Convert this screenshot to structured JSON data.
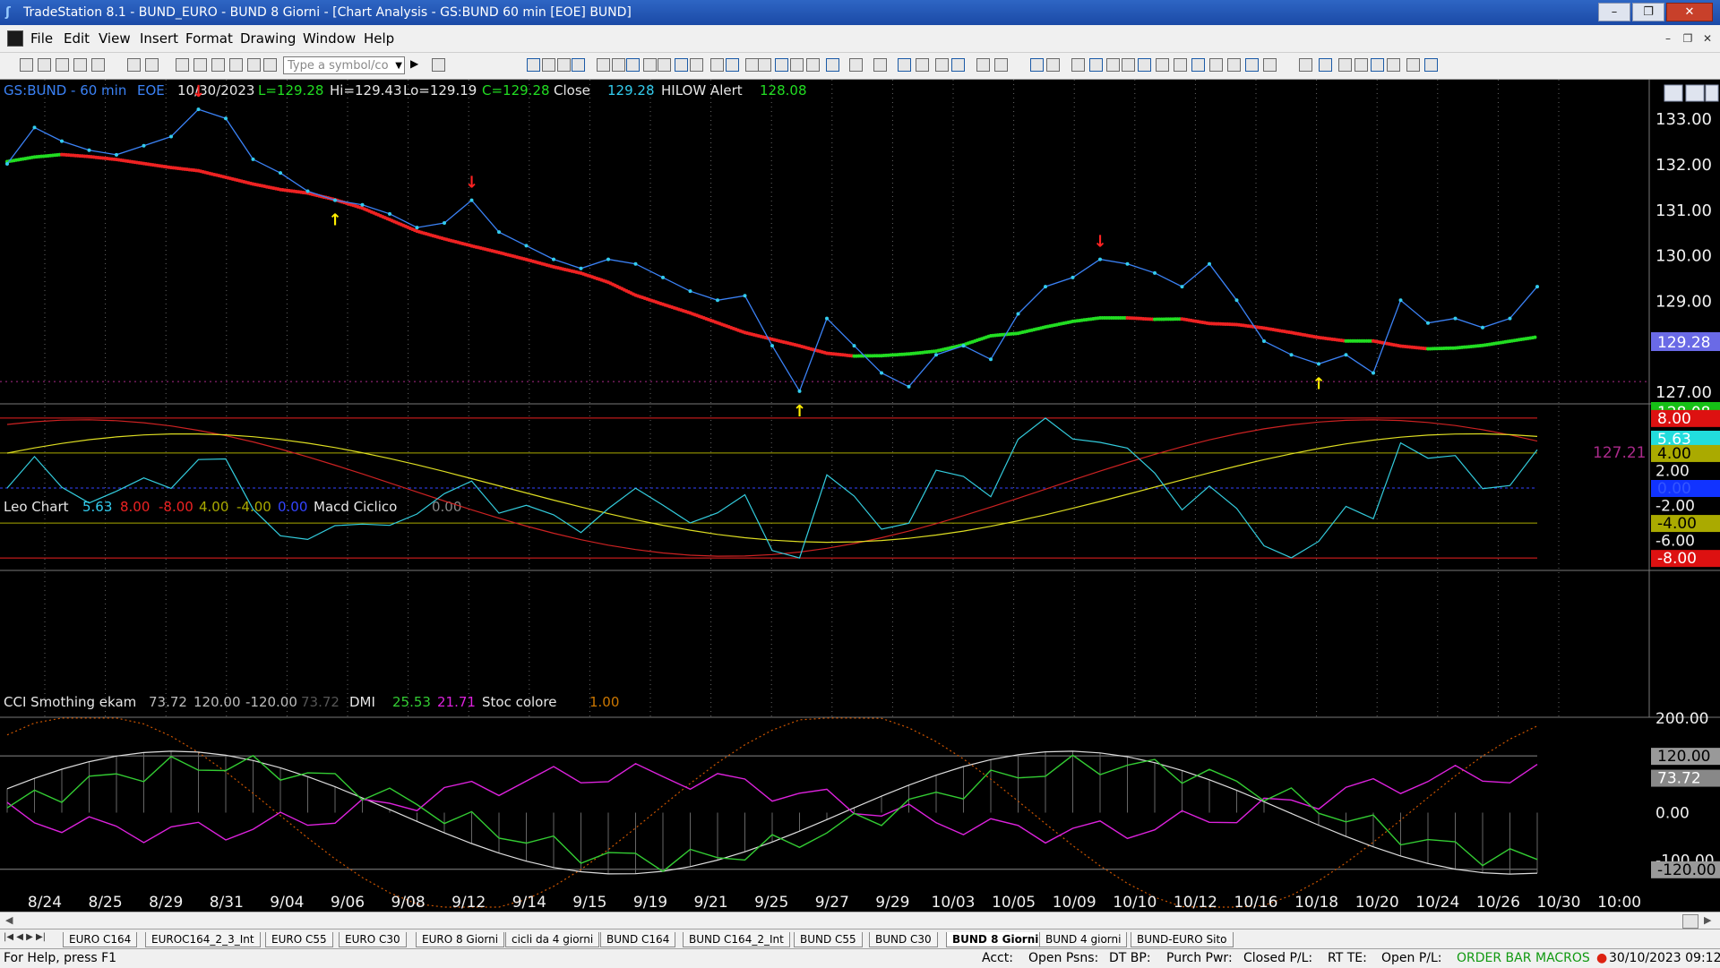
{
  "window": {
    "title": "TradeStation 8.1 - BUND_EURO - BUND 8 Giorni - [Chart Analysis - GS:BUND  60 min  [EOE] BUND]",
    "min_label": "–",
    "max_label": "❐",
    "close_label": "✕"
  },
  "menu": {
    "items": [
      "File",
      "Edit",
      "View",
      "Insert",
      "Format",
      "Drawing",
      "Window",
      "Help"
    ],
    "mdi_buttons": [
      "–",
      "❐",
      "✕"
    ]
  },
  "toolbar": {
    "symbol_placeholder": "Type a symbol/co"
  },
  "price_panel": {
    "header": {
      "symbol": "GS:BUND - 60 min",
      "session": "EOE",
      "date": "10/30/2023",
      "low": "L=129.28",
      "high": "Hi=129.43",
      "lo": "Lo=129.19",
      "close": "C=129.28",
      "close_label": "Close",
      "close_value": "129.28",
      "alert_label": "HILOW Alert",
      "alert_value": "128.08"
    },
    "axis_labels": [
      "133.00",
      "132.00",
      "131.00",
      "130.00",
      "129.00",
      "127.00"
    ],
    "last_price_badge": "129.28",
    "alert_badge": "128.08",
    "ref_line_label": "127.21",
    "ref_line_value": 127.21
  },
  "osc1_panel": {
    "header": {
      "name": "Leo Chart",
      "v1": "5.63",
      "v2": "8.00",
      "v3": "-8.00",
      "v4": "4.00",
      "v5": "-4.00",
      "v6": "0.00",
      "name2": "Macd Ciclico",
      "v7": "0.00"
    },
    "axis_labels": [
      "2.00",
      "-2.00",
      "-6.00"
    ],
    "badges": [
      "8.00",
      "5.63",
      "4.00",
      "0.00",
      "-4.00",
      "-8.00"
    ]
  },
  "osc2_panel": {
    "header": {
      "name": "CCI Smothing ekam",
      "v1": "73.72",
      "v2": "120.00",
      "v3": "-120.00",
      "v4": "73.72",
      "name2": "DMI",
      "v5": "25.53",
      "v6": "21.71",
      "name3": "Stoc colore",
      "v7": "1.00"
    },
    "axis_labels": [
      "200.00",
      "0.00",
      "-100.00"
    ],
    "badges": [
      "120.00",
      "73.72",
      "-120.00"
    ]
  },
  "x_axis": {
    "labels": [
      "8/24",
      "8/25",
      "8/29",
      "8/31",
      "9/04",
      "9/06",
      "9/08",
      "9/12",
      "9/14",
      "9/15",
      "9/19",
      "9/21",
      "9/25",
      "9/27",
      "9/29",
      "10/03",
      "10/05",
      "10/09",
      "10/10",
      "10/12",
      "10/16",
      "10/18",
      "10/20",
      "10/24",
      "10/26",
      "10/30",
      "10:00"
    ]
  },
  "chart_data": {
    "type": "line",
    "title": "",
    "series": [
      {
        "name": "GS:BUND - 60 min",
        "values": [
          132.0,
          132.8,
          132.5,
          132.3,
          132.2,
          132.4,
          132.6,
          133.2,
          133.0,
          132.1,
          131.8,
          131.4,
          131.2,
          131.1,
          130.9,
          130.6,
          130.7,
          131.2,
          130.5,
          130.2,
          129.9,
          129.7,
          129.9,
          129.8,
          129.5,
          129.2,
          129.0,
          129.1,
          128.0,
          127.0,
          128.6,
          128.0,
          127.4,
          127.1,
          127.8,
          128.0,
          127.7,
          128.7,
          129.3,
          129.5,
          129.9,
          129.8,
          129.6,
          129.3,
          129.8,
          129.0,
          128.1,
          127.8,
          127.6,
          127.8,
          127.4,
          129.0,
          128.5,
          128.6,
          128.4,
          128.6,
          129.3
        ]
      }
    ],
    "ylim": [
      126.8,
      133.3
    ]
  },
  "sheets": [
    "EURO C164",
    "EUROC164_2_3_Int",
    "EURO C55",
    "EURO C30",
    "EURO 8 Giorni",
    "cicli da 4 giorni",
    "BUND C164",
    "BUND C164_2_Int",
    "BUND C55",
    "BUND  C30",
    "BUND 8 Giorni",
    "BUND 4 giorni",
    "BUND-EURO Sito"
  ],
  "active_sheet": "BUND 8 Giorni",
  "status": {
    "help": "For Help, press F1",
    "acct": "Acct:",
    "open_psns": "Open Psns:",
    "dt_bp": "DT BP:",
    "purch_pwr": "Purch Pwr:",
    "closed_pl": "Closed P/L:",
    "rt_te": "RT TE:",
    "open_pl": "Open P/L:",
    "order_bar": "ORDER BAR",
    "macros": "MACROS",
    "datetime": "30/10/2023 09:12"
  },
  "colors": {
    "price": "#33ccee",
    "ma_down": "#ee2222",
    "ma_up": "#22dd22",
    "yellow": "#e6e600",
    "magenta": "#dd22dd",
    "green": "#33cc33"
  }
}
